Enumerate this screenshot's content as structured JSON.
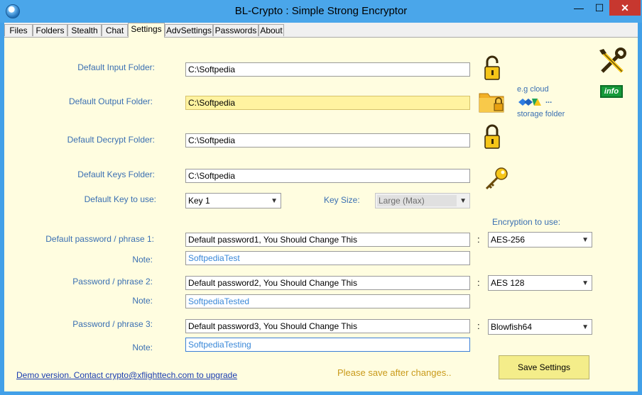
{
  "window": {
    "title": "BL-Crypto : Simple Strong Encryptor",
    "min_glyph": "—",
    "max_glyph": "☐",
    "close_glyph": "✕"
  },
  "tabs": [
    "Files",
    "Folders",
    "Stealth",
    "Chat",
    "Settings",
    "AdvSettings",
    "Passwords",
    "About"
  ],
  "active_tab": "Settings",
  "folders": {
    "input_label": "Default Input Folder:",
    "input_value": "C:\\Softpedia",
    "output_label": "Default Output Folder:",
    "output_value": "C:\\Softpedia",
    "decrypt_label": "Default Decrypt Folder:",
    "decrypt_value": "C:\\Softpedia",
    "keys_label": "Default Keys Folder:",
    "keys_value": "C:\\Softpedia"
  },
  "cloud": {
    "line1": "e.g cloud",
    "ellipsis": "...",
    "line2": "storage folder"
  },
  "key": {
    "label": "Default Key to use:",
    "value": "Key 1",
    "size_label": "Key Size:",
    "size_value": "Large (Max)"
  },
  "encryption_header": "Encryption to use:",
  "passwords": [
    {
      "label": "Default password / phrase 1:",
      "value": "Default password1, You Should Change This",
      "note_label": "Note:",
      "note": "SoftpediaTest",
      "encryption": "AES-256"
    },
    {
      "label": "Password / phrase 2:",
      "value": "Default password2, You Should Change This",
      "note_label": "Note:",
      "note": "SoftpediaTested",
      "encryption": "AES 128"
    },
    {
      "label": "Password / phrase 3:",
      "value": "Default password3, You Should Change This",
      "note_label": "Note:",
      "note": "SoftpediaTesting",
      "encryption": "Blowfish64"
    }
  ],
  "colon": ":",
  "footer": {
    "demo_link": "Demo version. Contact crypto@xflighttech.com to upgrade",
    "hint": "Please save after changes..",
    "save_label": "Save Settings"
  },
  "info_label": "info",
  "icons": [
    "app-icon",
    "lock-open-icon",
    "folder-lock-icon",
    "cloud-storage-icon",
    "lock-icon",
    "key-icon",
    "tools-icon",
    "info-icon"
  ],
  "colors": {
    "background": "#fffde0",
    "label": "#3a6fb2",
    "accent": "#42a0e8",
    "save": "#f4ed8a"
  }
}
